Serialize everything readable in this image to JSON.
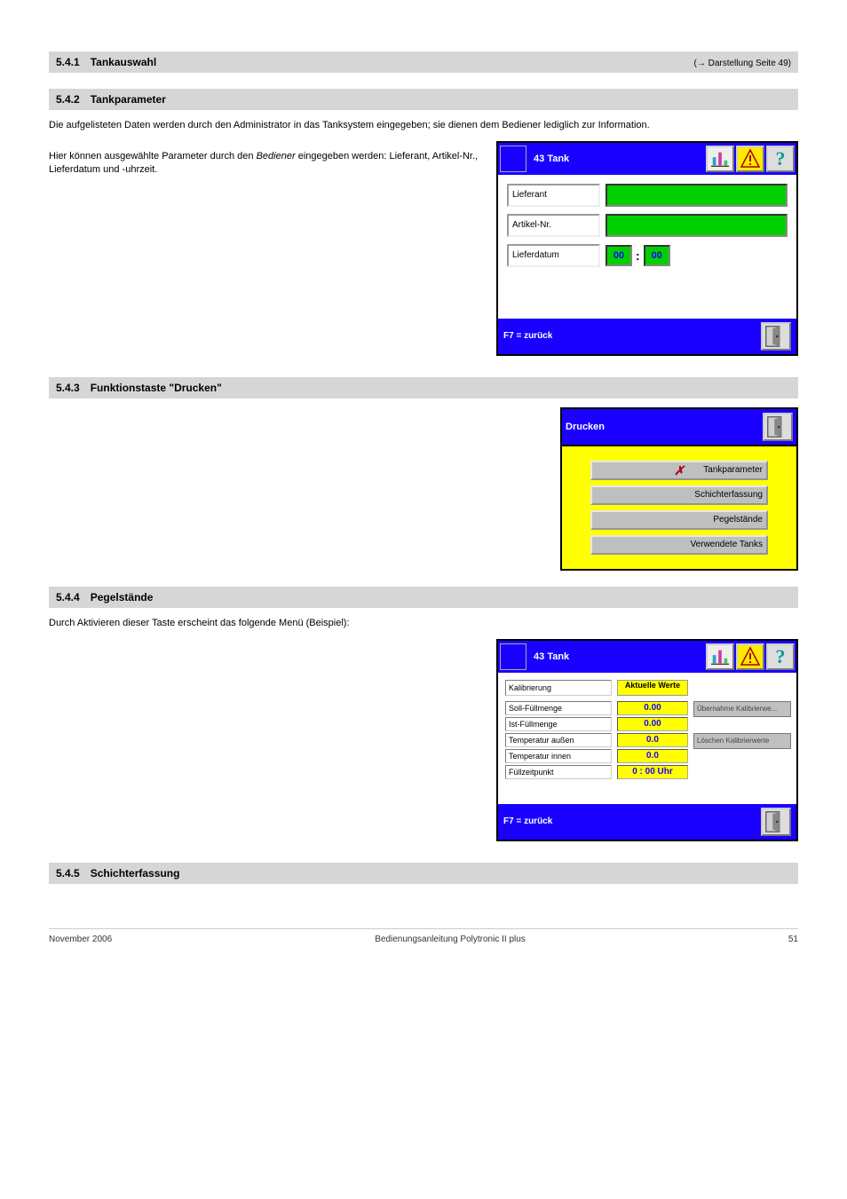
{
  "headings": {
    "h541": {
      "num": "5.4.1",
      "title": "Tankauswahl",
      "small": "(→ Darstellung Seite 49)"
    },
    "h542": {
      "num": "5.4.2",
      "title": "Tankparameter",
      "small": ""
    },
    "h543": {
      "num": "5.4.3",
      "title": "Funktionstaste \"Drucken\"",
      "small": ""
    },
    "h544": {
      "num": "5.4.4",
      "title": "Pegelstände",
      "small": ""
    },
    "h545": {
      "num": "5.4.5",
      "title": "Schichterfassung",
      "small": ""
    }
  },
  "para542a": "Die aufgelisteten Daten werden durch den Administrator in das Tanksystem eingegeben; sie dienen dem Bediener lediglich zur Information.",
  "para542b_1": "Hier können ausgewählte Parameter durch den ",
  "para542b_em": "Bediener",
  "para542b_2": " eingegeben werden: Lieferant, Artikel-Nr., Lieferdatum und -uhrzeit.",
  "para544": "Durch Aktivieren dieser Taste erscheint das folgende Menü (Beispiel):",
  "panel1": {
    "title_prefix": "43",
    "title": "Tank",
    "row1": "Lieferant",
    "row2": "Artikel-Nr.",
    "row3": "Lieferdatum",
    "hh": "00",
    "mm": "00",
    "footer": "F7 = zurück"
  },
  "panel2": {
    "title": "Drucken",
    "btn1_x": "✗",
    "btn1": "Tankparameter",
    "btn2": "Schichterfassung",
    "btn3": "Pegelstände",
    "btn4": "Verwendete Tanks"
  },
  "panel3": {
    "title_prefix": "43",
    "title": "Tank",
    "lbl_header": "Kalibrierung",
    "col1": "Aktuelle Werte",
    "lbl_soll": "Soll-Füllmenge",
    "lbl_ist": "Ist-Füllmenge",
    "lbl_tempa": "Temperatur außen",
    "lbl_tempi": "Temperatur innen",
    "lbl_fz": "Füllzeitpunkt",
    "v_soll": "0.00",
    "v_ist": "0.00",
    "v_tempa": "0.0",
    "v_tempi": "0.0",
    "v_fz": "0 : 00 Uhr",
    "side1": "Übernahme Kalibrierwe...",
    "side2": "Löschen Kalibrierwerte",
    "footer": "F7 = zurück"
  },
  "pageFooter": {
    "left": "November 2006",
    "mid": "Bedienungsanleitung Polytronic II plus",
    "right": "51"
  }
}
